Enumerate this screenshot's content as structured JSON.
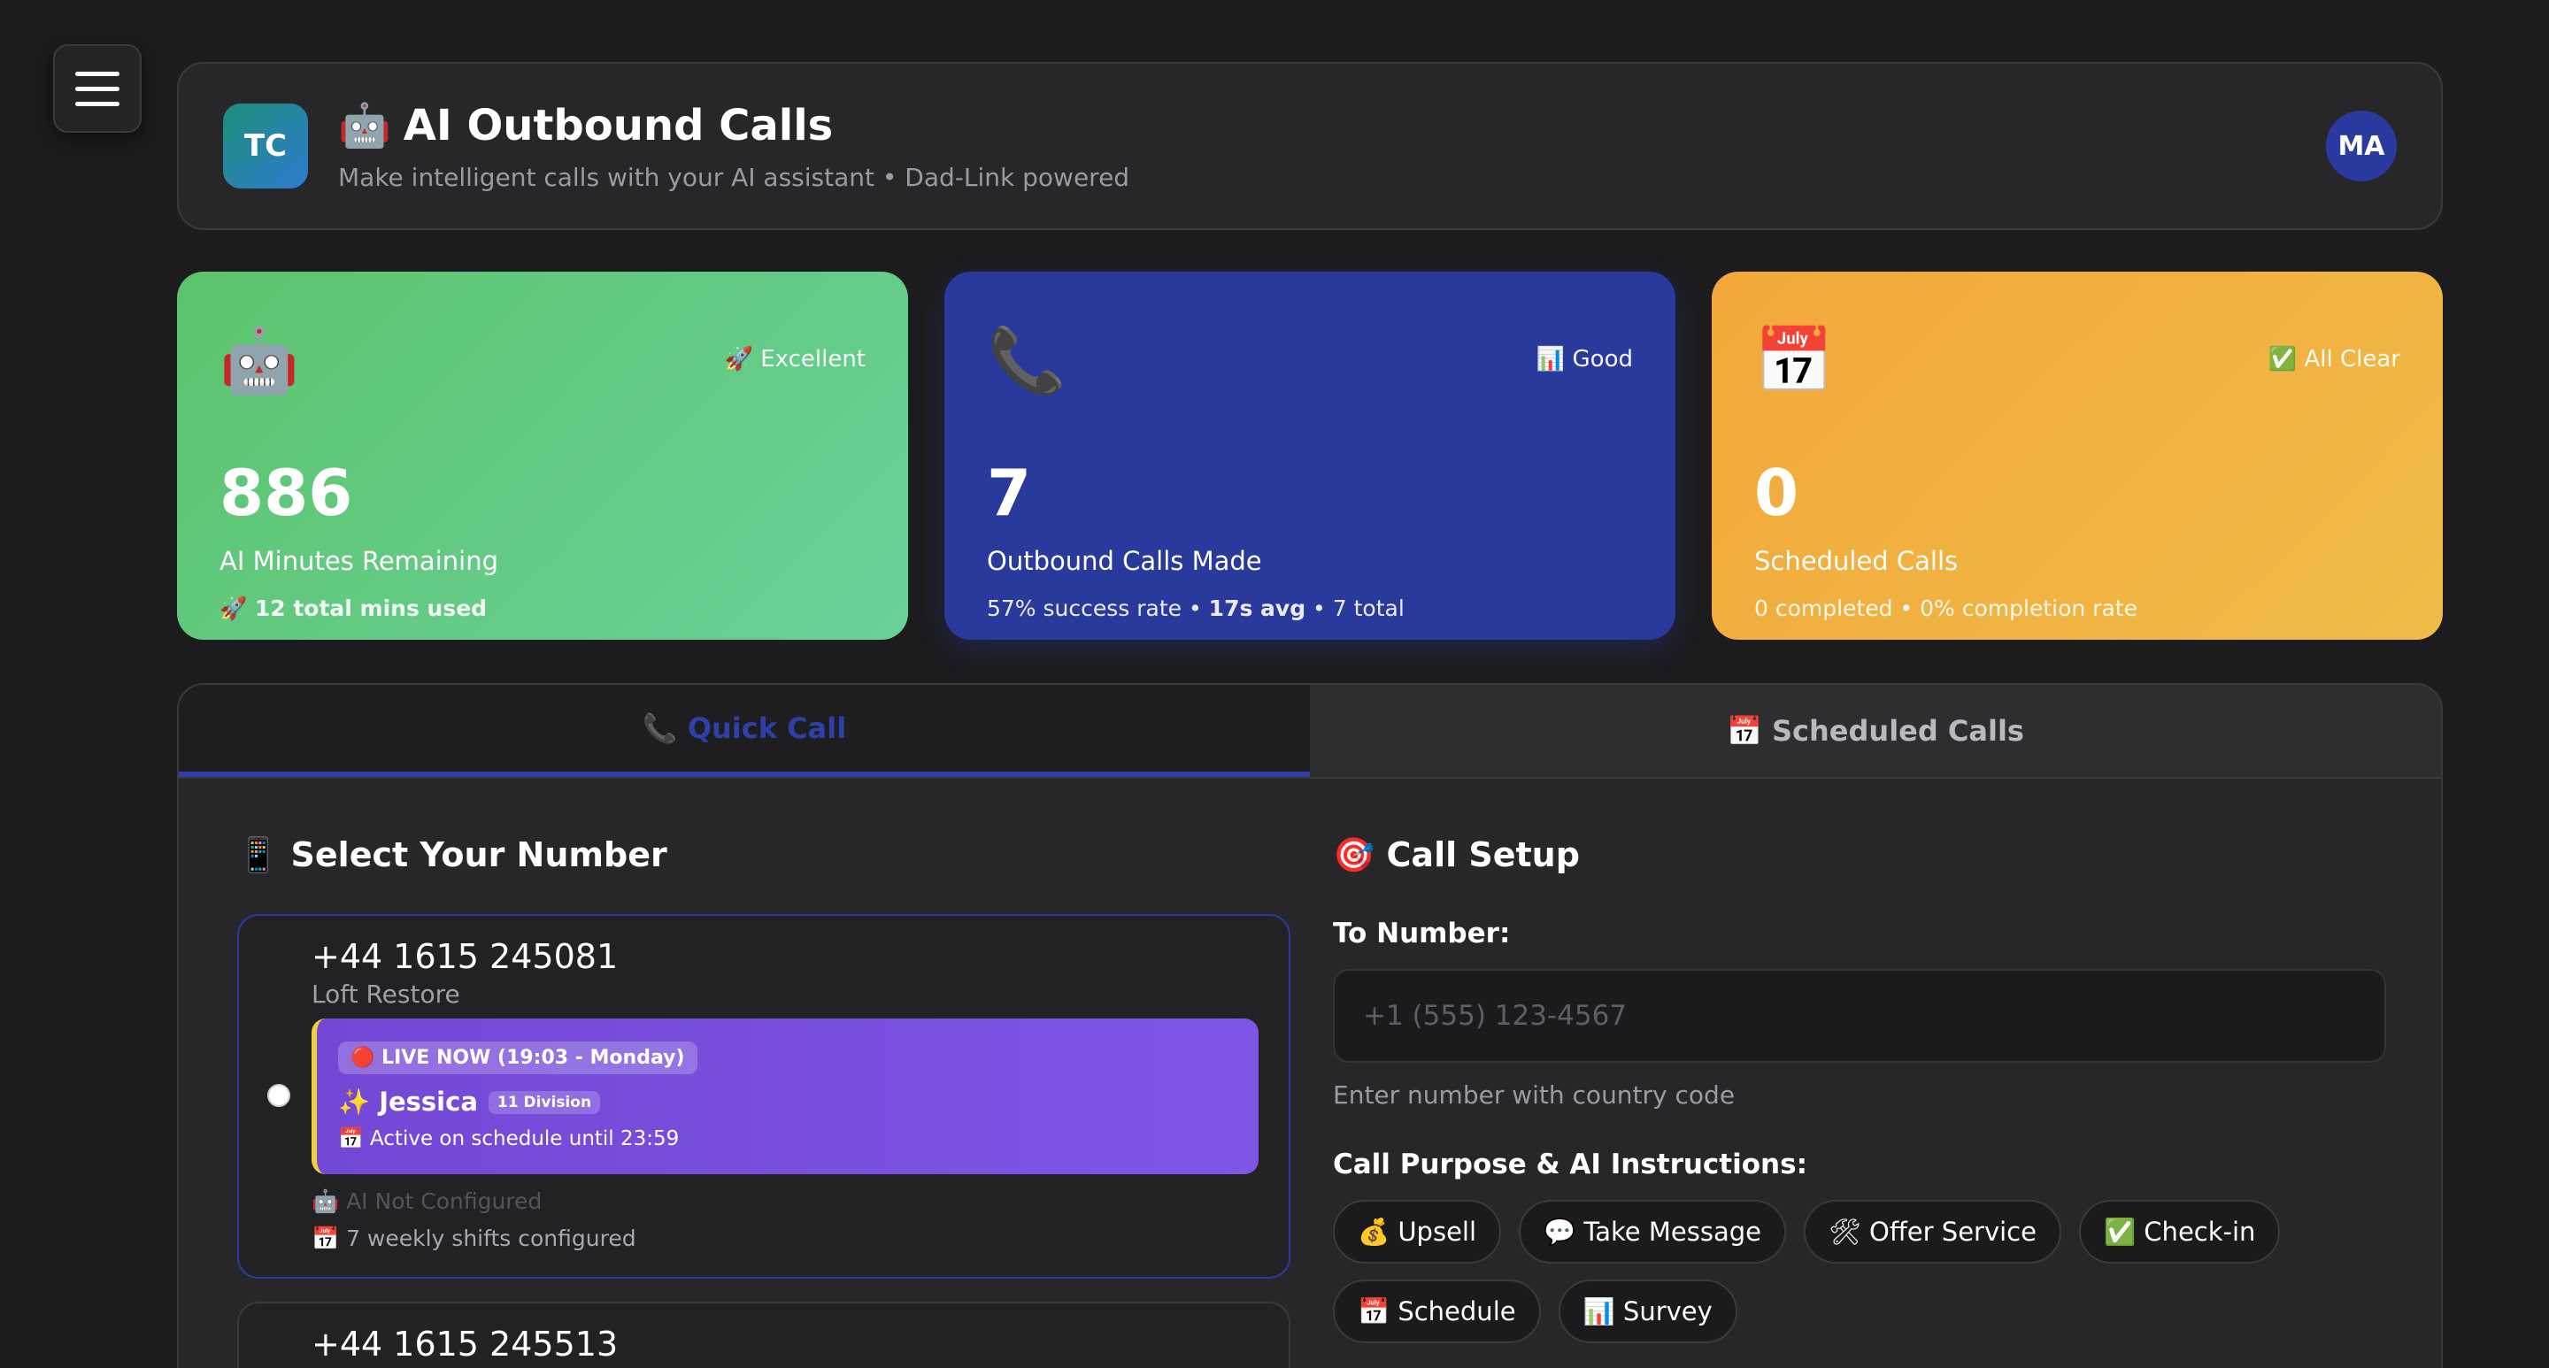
{
  "header": {
    "logo_initials": "TC",
    "title_icon": "🤖",
    "title": "AI Outbound Calls",
    "subtitle": "Make intelligent calls with your AI assistant • Dad-Link powered",
    "avatar_initials": "MA"
  },
  "stats": [
    {
      "icon": "🤖",
      "badge": "🚀 Excellent",
      "value": "886",
      "label": "AI Minutes Remaining",
      "detail_bold": "🚀 12 total mins used",
      "color": "#5cc46c"
    },
    {
      "icon": "📞",
      "badge": "📊 Good",
      "value": "7",
      "label": "Outbound Calls Made",
      "detail_pre": "57% success rate • ",
      "detail_bold": "17s avg",
      "detail_post": " • 7 total",
      "color": "#2a3a9c"
    },
    {
      "icon": "📅",
      "badge": "✅ All Clear",
      "value": "0",
      "label": "Scheduled Calls",
      "detail": "0 completed • 0% completion rate",
      "color": "#f2a83a"
    }
  ],
  "tabs": {
    "quick_call": "📞 Quick Call",
    "scheduled_calls": "📅 Scheduled Calls"
  },
  "select_number": {
    "title": "📱 Select Your Number",
    "numbers": [
      {
        "phone": "+44 1615 245081",
        "name": "Loft Restore",
        "live_label": "🔴 LIVE NOW (19:03 - Monday)",
        "agent": "✨ Jessica",
        "division": "11 Division",
        "active_text": "📅 Active on schedule until 23:59",
        "ai_status": "🤖 AI Not Configured",
        "shifts": "📅 7 weekly shifts configured"
      },
      {
        "phone": "+44 1615 245513"
      }
    ]
  },
  "call_setup": {
    "title": "🎯 Call Setup",
    "to_number_label": "To Number:",
    "to_number_placeholder": "+1 (555) 123-4567",
    "to_number_hint": "Enter number with country code",
    "purpose_label": "Call Purpose & AI Instructions:",
    "purposes": [
      "💰 Upsell",
      "💬 Take Message",
      "🛠 Offer Service",
      "✅ Check-in",
      "📅 Schedule",
      "📊 Survey"
    ]
  },
  "colors": {
    "accent": "#2f3fa8",
    "background": "#1c1c1e",
    "card_green": "#5cc46c",
    "card_blue": "#2a3a9c",
    "card_orange": "#f2a83a",
    "live_purple": "#7f56e6"
  }
}
